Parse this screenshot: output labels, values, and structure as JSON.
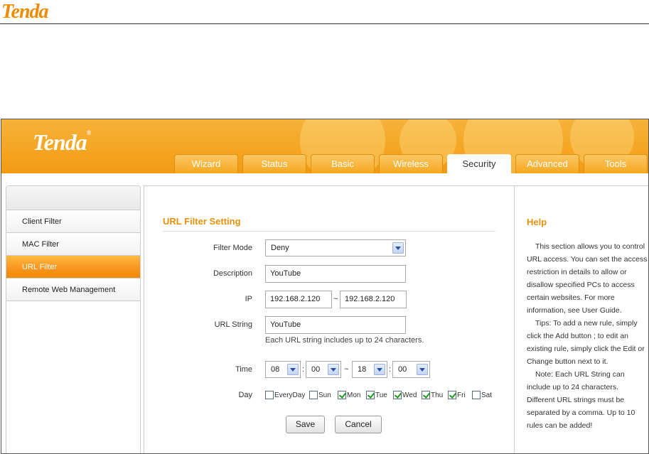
{
  "doc": {
    "logo": "Tenda"
  },
  "header": {
    "brand": "Tenda",
    "reg": "®"
  },
  "tabs": [
    {
      "label": "Wizard",
      "active": false
    },
    {
      "label": "Status",
      "active": false
    },
    {
      "label": "Basic",
      "active": false
    },
    {
      "label": "Wireless",
      "active": false
    },
    {
      "label": "Security",
      "active": true
    },
    {
      "label": "Advanced",
      "active": false
    },
    {
      "label": "Tools",
      "active": false
    }
  ],
  "sidebar": {
    "items": [
      {
        "label": "Client Filter",
        "active": false
      },
      {
        "label": "MAC Filter",
        "active": false
      },
      {
        "label": "URL Filter",
        "active": true
      },
      {
        "label": "Remote Web Management",
        "active": false
      }
    ]
  },
  "form": {
    "title": "URL Filter Setting",
    "filter_mode_label": "Filter Mode",
    "filter_mode_value": "Deny",
    "description_label": "Description",
    "description_value": "YouTube",
    "ip_label": "IP",
    "ip_start": "192.168.2.120",
    "ip_sep": "~",
    "ip_end": "192.168.2.120",
    "url_label": "URL String",
    "url_value": "YouTube",
    "url_hint": "Each URL string includes up to 24 characters.",
    "time_label": "Time",
    "time_start_hour": "08",
    "time_colon": ":",
    "time_start_min": "00",
    "time_sep": "~",
    "time_end_hour": "18",
    "time_end_min": "00",
    "day_label": "Day",
    "days": [
      {
        "label": "EveryDay",
        "checked": false
      },
      {
        "label": "Sun",
        "checked": false
      },
      {
        "label": "Mon",
        "checked": true
      },
      {
        "label": "Tue",
        "checked": true
      },
      {
        "label": "Wed",
        "checked": true
      },
      {
        "label": "Thu",
        "checked": true
      },
      {
        "label": "Fri",
        "checked": true
      },
      {
        "label": "Sat",
        "checked": false
      }
    ],
    "save_label": "Save",
    "cancel_label": "Cancel"
  },
  "help": {
    "title": "Help",
    "p1": "This section allows you to control URL access. You can set the access restriction in details to allow or disallow specified PCs to access certain websites. For more information, see User Guide.",
    "p2": "Tips: To add a new rule, simply click the Add button ; to edit an existing rule, simply click the Edit or Change button next to it.",
    "p3": "Note: Each URL String can include up to 24 characters. Different URL strings must be separated by a comma. Up to 10 rules can be added!"
  },
  "colors": {
    "accent": "#f5a623",
    "title": "#e8910a",
    "check": "#1a9a1a"
  }
}
